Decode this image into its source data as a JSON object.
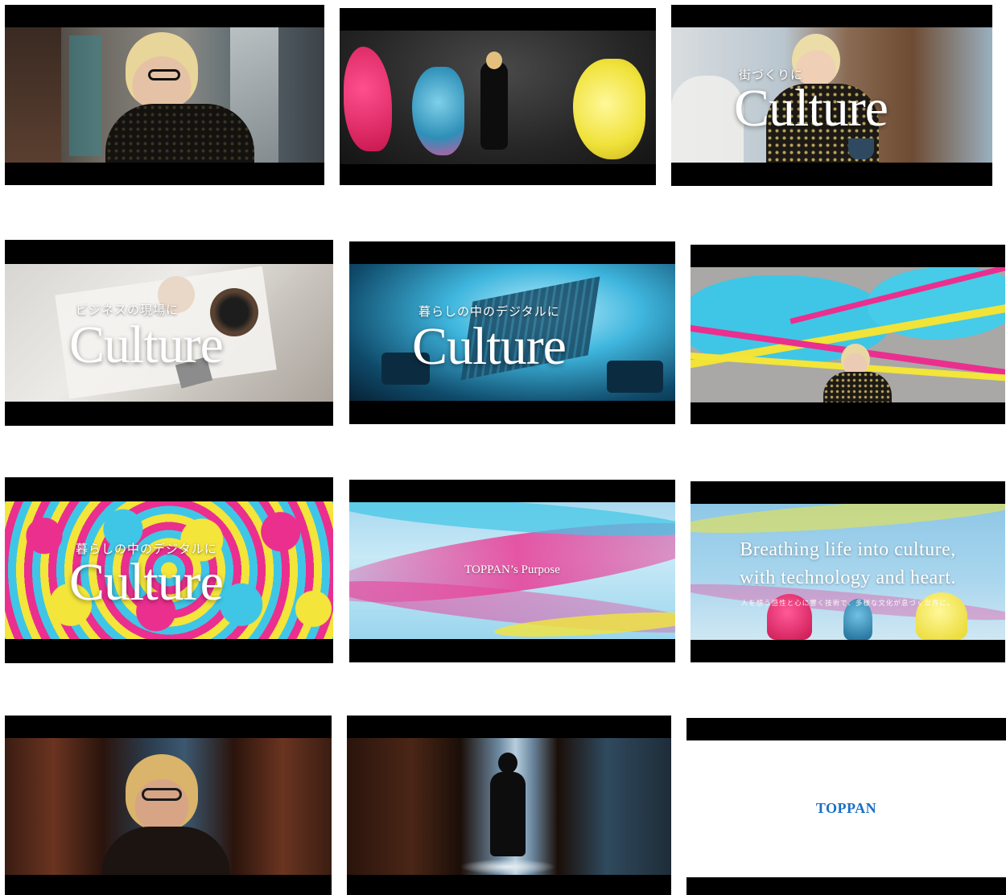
{
  "frames": [
    {
      "id": 1,
      "subtitle": "",
      "headline": ""
    },
    {
      "id": 2,
      "subtitle": "",
      "headline": ""
    },
    {
      "id": 3,
      "subtitle": "街づくりに",
      "headline": "Culture"
    },
    {
      "id": 4,
      "subtitle": "ビジネスの現場に",
      "headline": "Culture"
    },
    {
      "id": 5,
      "subtitle": "暮らしの中のデジタルに",
      "headline": "Culture"
    },
    {
      "id": 6,
      "subtitle": "",
      "headline": ""
    },
    {
      "id": 7,
      "subtitle": "暮らしの中のデジタルに",
      "headline": "Culture"
    },
    {
      "id": 8,
      "caption": "TOPPAN’s Purpose"
    },
    {
      "id": 9,
      "tagline_line1": "Breathing life into culture,",
      "tagline_line2": "with technology and heart.",
      "tagline_sub": "人を想う感性と心に響く技術で、多様な文化が息づく世界に。"
    },
    {
      "id": 10,
      "subtitle": "",
      "headline": ""
    },
    {
      "id": 11,
      "subtitle": "",
      "headline": ""
    },
    {
      "id": 12,
      "logo": "TOPPAN"
    }
  ],
  "colors": {
    "logo": "#1a6fc4",
    "letterbox": "#000000",
    "page": "#ffffff"
  }
}
